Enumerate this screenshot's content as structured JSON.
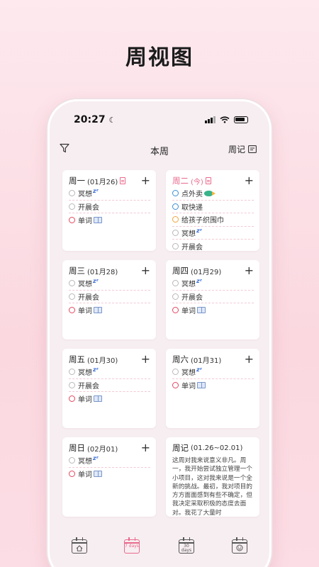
{
  "promo_title": "周视图",
  "status": {
    "time": "20:27"
  },
  "header": {
    "title": "本周",
    "journal_label": "周记"
  },
  "days": [
    {
      "day": "周一",
      "date": "(01月26)",
      "today": false,
      "has_note": true,
      "tasks": [
        {
          "text": "冥想",
          "color": "gray",
          "emoji": "zz"
        },
        {
          "text": "开晨会",
          "color": "gray"
        },
        {
          "text": "单词",
          "color": "red",
          "emoji": "book"
        }
      ]
    },
    {
      "day": "周二",
      "date": "(今)",
      "today": true,
      "has_note": true,
      "tasks": [
        {
          "text": "点外卖",
          "color": "blue",
          "emoji": "fish"
        },
        {
          "text": "取快递",
          "color": "blue"
        },
        {
          "text": "给孩子织围巾",
          "color": "orange"
        },
        {
          "text": "冥想",
          "color": "gray",
          "emoji": "zz"
        },
        {
          "text": "开晨会",
          "color": "gray"
        }
      ]
    },
    {
      "day": "周三",
      "date": "(01月28)",
      "today": false,
      "tasks": [
        {
          "text": "冥想",
          "color": "gray",
          "emoji": "zz"
        },
        {
          "text": "开晨会",
          "color": "gray"
        },
        {
          "text": "单词",
          "color": "red",
          "emoji": "book"
        }
      ]
    },
    {
      "day": "周四",
      "date": "(01月29)",
      "today": false,
      "tasks": [
        {
          "text": "冥想",
          "color": "gray",
          "emoji": "zz"
        },
        {
          "text": "开晨会",
          "color": "gray"
        },
        {
          "text": "单词",
          "color": "red",
          "emoji": "book"
        }
      ]
    },
    {
      "day": "周五",
      "date": "(01月30)",
      "today": false,
      "tasks": [
        {
          "text": "冥想",
          "color": "gray",
          "emoji": "zz"
        },
        {
          "text": "开晨会",
          "color": "gray"
        },
        {
          "text": "单词",
          "color": "red",
          "emoji": "book"
        }
      ]
    },
    {
      "day": "周六",
      "date": "(01月31)",
      "today": false,
      "tasks": [
        {
          "text": "冥想",
          "color": "gray",
          "emoji": "zz"
        },
        {
          "text": "单词",
          "color": "red",
          "emoji": "book"
        }
      ]
    },
    {
      "day": "周日",
      "date": "(02月01)",
      "today": false,
      "tasks": [
        {
          "text": "冥想",
          "color": "gray",
          "emoji": "zz"
        },
        {
          "text": "单词",
          "color": "red",
          "emoji": "book"
        }
      ]
    }
  ],
  "journal": {
    "title": "周记",
    "range": "(01.26~02.01)",
    "text": "这周对我来说意义非凡。周一，我开始尝试独立管理一个小项目，这对我来说是一个全新的挑战。最初，我对项目的方方面面感到有些不确定，但我决定采取积极的态度去面对。我花了大量时"
  },
  "tabs": [
    {
      "name": "home",
      "label": "",
      "active": false
    },
    {
      "name": "7days",
      "label": "7 days",
      "active": true
    },
    {
      "name": "30days",
      "label": "30 days",
      "active": false
    },
    {
      "name": "mood",
      "label": "",
      "active": false
    }
  ],
  "colors": {
    "accent": "#e96a8d",
    "gray": "#b8b8b8",
    "red": "#e4465e",
    "blue": "#3a8fd6",
    "orange": "#f0a43c"
  }
}
